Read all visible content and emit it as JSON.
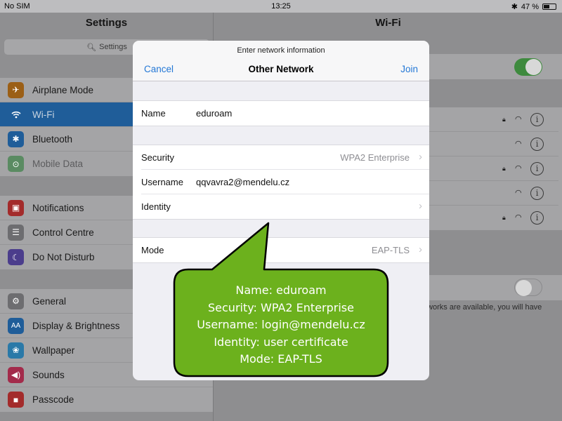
{
  "status_bar": {
    "carrier": "No SIM",
    "time": "13:25",
    "battery": "47 %",
    "battery_level": 0.47
  },
  "sidebar": {
    "title": "Settings",
    "search_placeholder": "Settings",
    "groups": [
      [
        {
          "label": "Airplane Mode",
          "icon": "airplane-icon",
          "color": "#9b5f16"
        },
        {
          "label": "Wi-Fi",
          "icon": "wifi-icon",
          "color": "#1f5d99",
          "selected": true
        },
        {
          "label": "Bluetooth",
          "icon": "bluetooth-icon",
          "color": "#1f5d99"
        },
        {
          "label": "Mobile Data",
          "icon": "antenna-icon",
          "color": "#5a8b62",
          "dim": true
        }
      ],
      [
        {
          "label": "Notifications",
          "icon": "notifications-icon",
          "color": "#a32b2b"
        },
        {
          "label": "Control Centre",
          "icon": "toggles-icon",
          "color": "#6d6d70"
        },
        {
          "label": "Do Not Disturb",
          "icon": "moon-icon",
          "color": "#4b3d8c"
        }
      ],
      [
        {
          "label": "General",
          "icon": "gear-icon",
          "color": "#6d6d70"
        },
        {
          "label": "Display & Brightness",
          "icon": "display-icon",
          "color": "#1f5d99"
        },
        {
          "label": "Wallpaper",
          "icon": "wallpaper-icon",
          "color": "#2a79a8"
        },
        {
          "label": "Sounds",
          "icon": "speaker-icon",
          "color": "#a32b4b"
        },
        {
          "label": "Passcode",
          "icon": "lock-icon",
          "color": "#a32b2b"
        }
      ]
    ]
  },
  "wifi_panel": {
    "title": "Wi-Fi",
    "footer_text": "tworks are available, you will have",
    "wifi_toggle_on": true,
    "ask_toggle_on": false
  },
  "modal": {
    "prompt": "Enter network information",
    "title": "Other Network",
    "cancel_label": "Cancel",
    "join_label": "Join",
    "name_label": "Name",
    "name_value": "eduroam",
    "security_label": "Security",
    "security_value": "WPA2 Enterprise",
    "username_label": "Username",
    "username_value": "qqvavra2@mendelu.cz",
    "identity_label": "Identity",
    "mode_label": "Mode",
    "mode_value": "EAP-TLS"
  },
  "callout": {
    "lines": [
      "Name: eduroam",
      "Security: WPA2 Enterprise",
      "Username: login@mendelu.cz",
      "Identity: user certificate",
      "Mode: EAP-TLS"
    ],
    "fill": "#6cb11d",
    "stroke": "#000000"
  },
  "colors": {
    "accent": "#2478d6",
    "toggle_on": "#3e8a3e"
  }
}
